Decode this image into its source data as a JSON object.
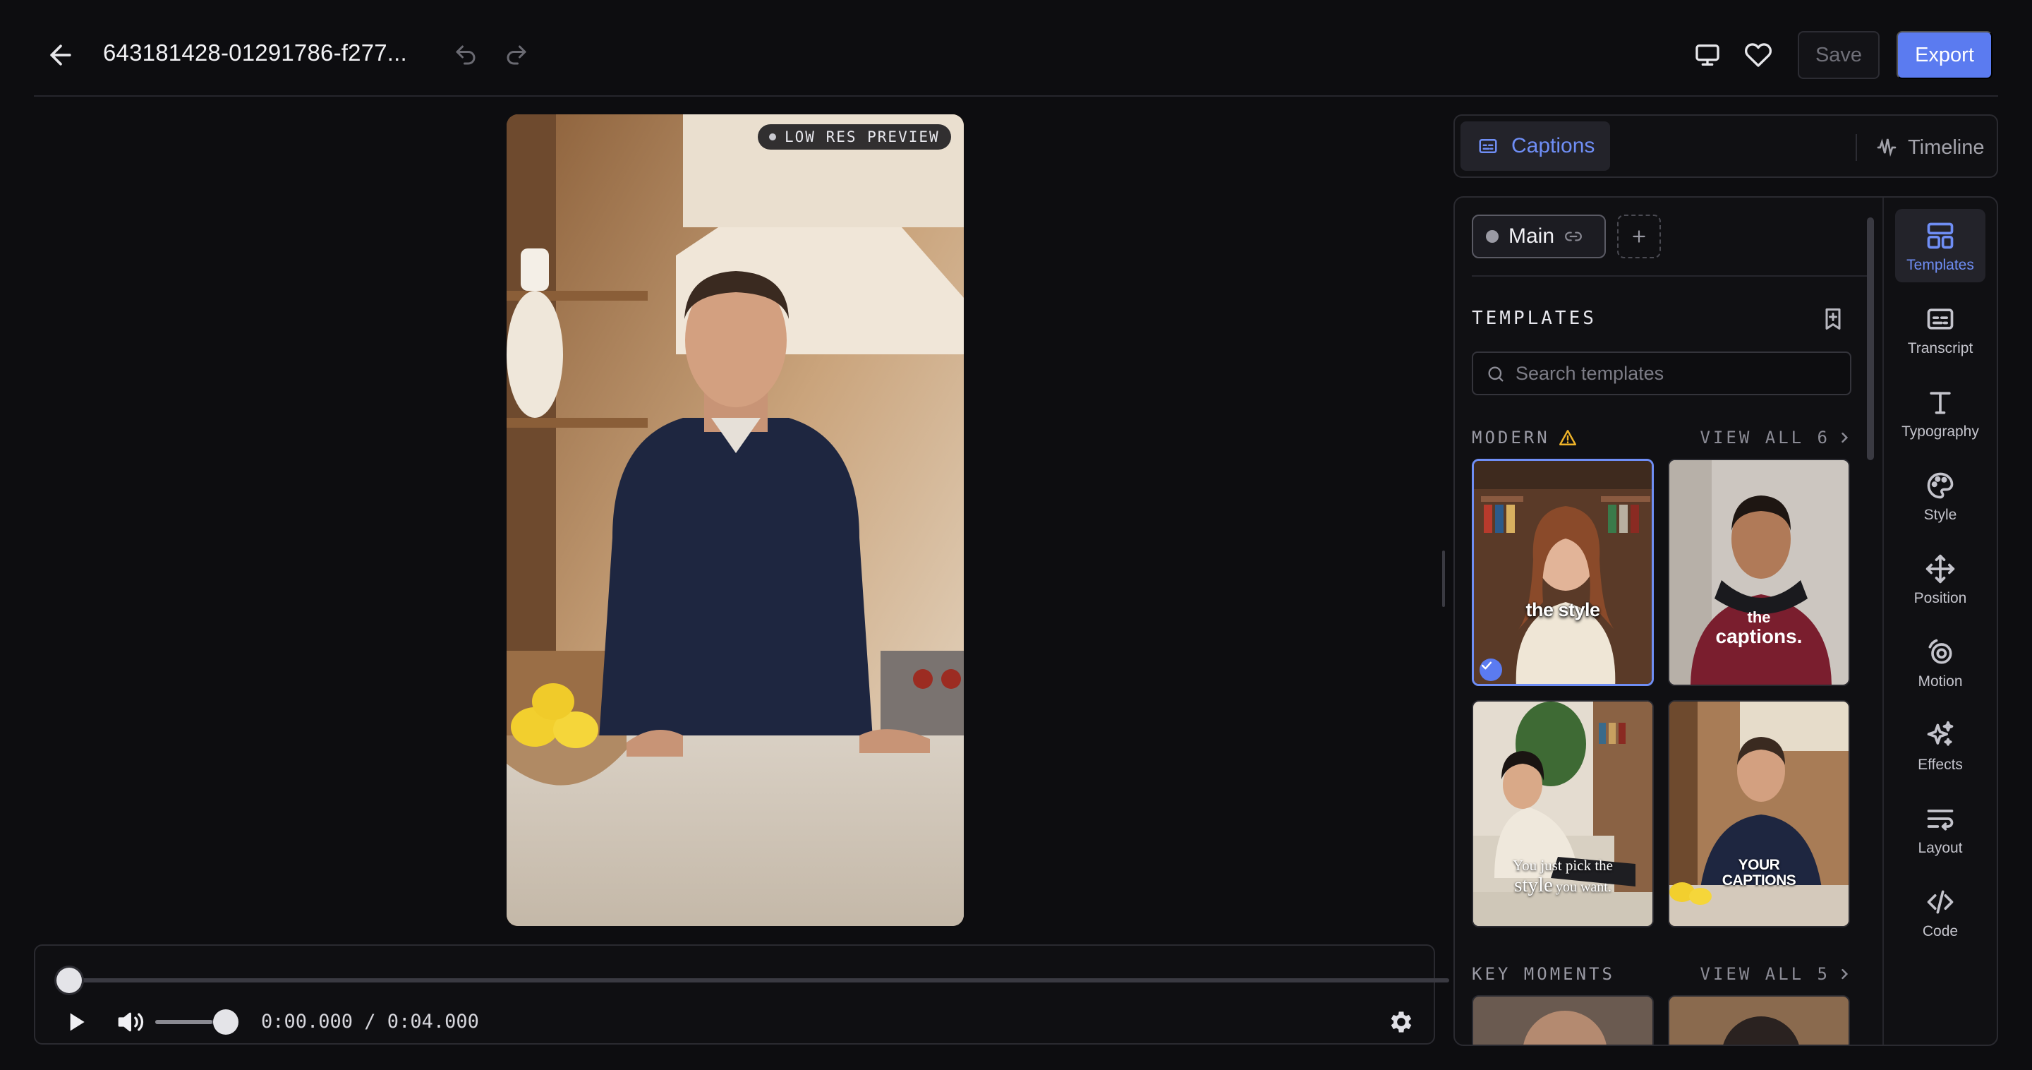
{
  "header": {
    "title": "643181428-01291786-f277...",
    "save_label": "Save",
    "export_label": "Export"
  },
  "preview": {
    "badge": "LOW RES PREVIEW"
  },
  "player": {
    "time": "0:00.000 / 0:04.000",
    "progress": 0.0,
    "volume": 0.75
  },
  "tabs": {
    "captions": "Captions",
    "timeline": "Timeline"
  },
  "panel": {
    "layer_name": "Main",
    "templates_heading": "TEMPLATES",
    "search_placeholder": "Search templates",
    "sections": [
      {
        "label": "MODERN",
        "view_all": "VIEW ALL 6",
        "templates": [
          {
            "caption": "the style",
            "selected": true
          },
          {
            "caption": "the captions.",
            "line1": "the",
            "line2": "captions.",
            "selected": false
          },
          {
            "caption": "You just pick the style you want.",
            "line1": "You just pick the",
            "line2a": "style",
            "line2b": "you want.",
            "selected": false
          },
          {
            "caption": "YOUR CAPTIONS",
            "line1": "YOUR",
            "line2": "CAPTIONS",
            "selected": false
          }
        ]
      },
      {
        "label": "KEY MOMENTS",
        "view_all": "VIEW ALL 5"
      }
    ]
  },
  "side_tools": [
    {
      "label": "Templates",
      "icon": "templates-icon",
      "active": true
    },
    {
      "label": "Transcript",
      "icon": "transcript-icon",
      "active": false
    },
    {
      "label": "Typography",
      "icon": "typography-icon",
      "active": false
    },
    {
      "label": "Style",
      "icon": "palette-icon",
      "active": false
    },
    {
      "label": "Position",
      "icon": "move-icon",
      "active": false
    },
    {
      "label": "Motion",
      "icon": "motion-icon",
      "active": false
    },
    {
      "label": "Effects",
      "icon": "sparkles-icon",
      "active": false
    },
    {
      "label": "Layout",
      "icon": "wrap-text-icon",
      "active": false
    },
    {
      "label": "Code",
      "icon": "code-icon",
      "active": false
    }
  ],
  "colors": {
    "accent": "#5b7bf0",
    "accent_text": "#6f8ef5",
    "background": "#0d0d10",
    "warning": "#f0b429"
  }
}
